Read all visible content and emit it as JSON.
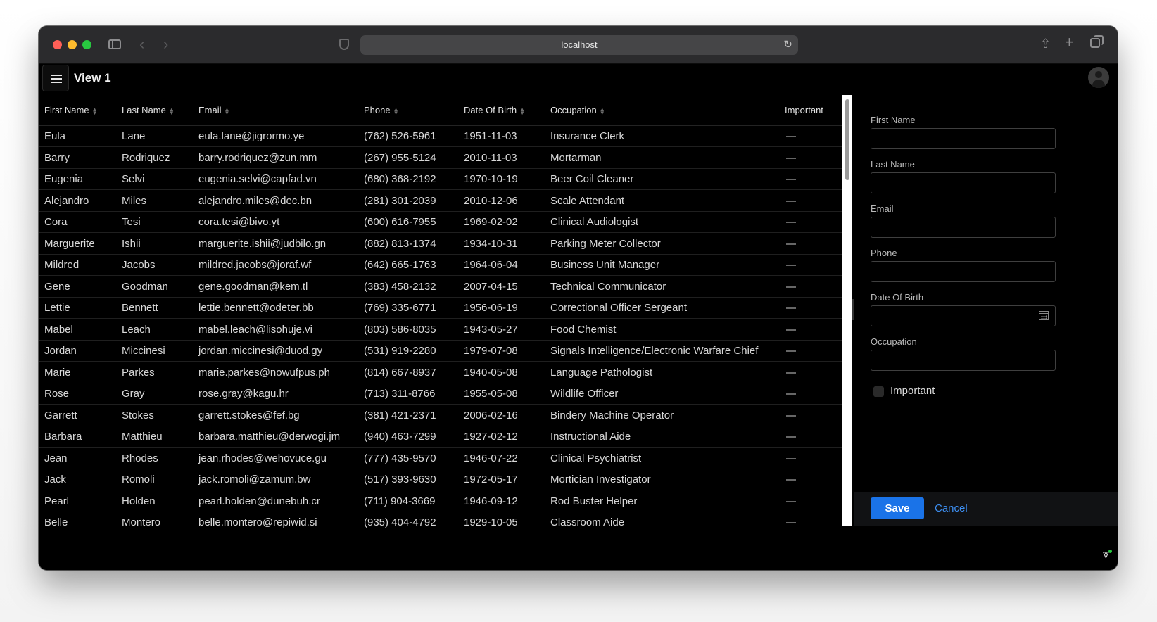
{
  "browser": {
    "address": "localhost"
  },
  "header": {
    "title": "View 1"
  },
  "grid": {
    "columns": [
      "First Name",
      "Last Name",
      "Email",
      "Phone",
      "Date Of Birth",
      "Occupation",
      "Important"
    ],
    "rows": [
      [
        "Eula",
        "Lane",
        "eula.lane@jigrormo.ye",
        "(762) 526-5961",
        "1951-11-03",
        "Insurance Clerk"
      ],
      [
        "Barry",
        "Rodriquez",
        "barry.rodriquez@zun.mm",
        "(267) 955-5124",
        "2010-11-03",
        "Mortarman"
      ],
      [
        "Eugenia",
        "Selvi",
        "eugenia.selvi@capfad.vn",
        "(680) 368-2192",
        "1970-10-19",
        "Beer Coil Cleaner"
      ],
      [
        "Alejandro",
        "Miles",
        "alejandro.miles@dec.bn",
        "(281) 301-2039",
        "2010-12-06",
        "Scale Attendant"
      ],
      [
        "Cora",
        "Tesi",
        "cora.tesi@bivo.yt",
        "(600) 616-7955",
        "1969-02-02",
        "Clinical Audiologist"
      ],
      [
        "Marguerite",
        "Ishii",
        "marguerite.ishii@judbilo.gn",
        "(882) 813-1374",
        "1934-10-31",
        "Parking Meter Collector"
      ],
      [
        "Mildred",
        "Jacobs",
        "mildred.jacobs@joraf.wf",
        "(642) 665-1763",
        "1964-06-04",
        "Business Unit Manager"
      ],
      [
        "Gene",
        "Goodman",
        "gene.goodman@kem.tl",
        "(383) 458-2132",
        "2007-04-15",
        "Technical Communicator"
      ],
      [
        "Lettie",
        "Bennett",
        "lettie.bennett@odeter.bb",
        "(769) 335-6771",
        "1956-06-19",
        "Correctional Officer Sergeant"
      ],
      [
        "Mabel",
        "Leach",
        "mabel.leach@lisohuje.vi",
        "(803) 586-8035",
        "1943-05-27",
        "Food Chemist"
      ],
      [
        "Jordan",
        "Miccinesi",
        "jordan.miccinesi@duod.gy",
        "(531) 919-2280",
        "1979-07-08",
        "Signals Intelligence/Electronic Warfare Chief"
      ],
      [
        "Marie",
        "Parkes",
        "marie.parkes@nowufpus.ph",
        "(814) 667-8937",
        "1940-05-08",
        "Language Pathologist"
      ],
      [
        "Rose",
        "Gray",
        "rose.gray@kagu.hr",
        "(713) 311-8766",
        "1955-05-08",
        "Wildlife Officer"
      ],
      [
        "Garrett",
        "Stokes",
        "garrett.stokes@fef.bg",
        "(381) 421-2371",
        "2006-02-16",
        "Bindery Machine Operator"
      ],
      [
        "Barbara",
        "Matthieu",
        "barbara.matthieu@derwogi.jm",
        "(940) 463-7299",
        "1927-02-12",
        "Instructional Aide"
      ],
      [
        "Jean",
        "Rhodes",
        "jean.rhodes@wehovuce.gu",
        "(777) 435-9570",
        "1946-07-22",
        "Clinical Psychiatrist"
      ],
      [
        "Jack",
        "Romoli",
        "jack.romoli@zamum.bw",
        "(517) 393-9630",
        "1972-05-17",
        "Mortician Investigator"
      ],
      [
        "Pearl",
        "Holden",
        "pearl.holden@dunebuh.cr",
        "(711) 904-3669",
        "1946-09-12",
        "Rod Buster Helper"
      ],
      [
        "Belle",
        "Montero",
        "belle.montero@repiwid.si",
        "(935) 404-4792",
        "1929-10-05",
        "Classroom Aide"
      ]
    ]
  },
  "form": {
    "fields": [
      "First Name",
      "Last Name",
      "Email",
      "Phone",
      "Date Of Birth",
      "Occupation"
    ],
    "checkbox_label": "Important",
    "save_label": "Save",
    "cancel_label": "Cancel"
  },
  "colors": {
    "accent": "#1a73e8",
    "link": "#3d8ef0",
    "background": "#000000"
  },
  "icons": [
    "menu-icon",
    "user-avatar-icon",
    "sort-icon",
    "calendar-icon",
    "dash-icon",
    "reload-icon",
    "share-icon",
    "plus-icon",
    "tabs-icon",
    "dev-tools-icon"
  ]
}
